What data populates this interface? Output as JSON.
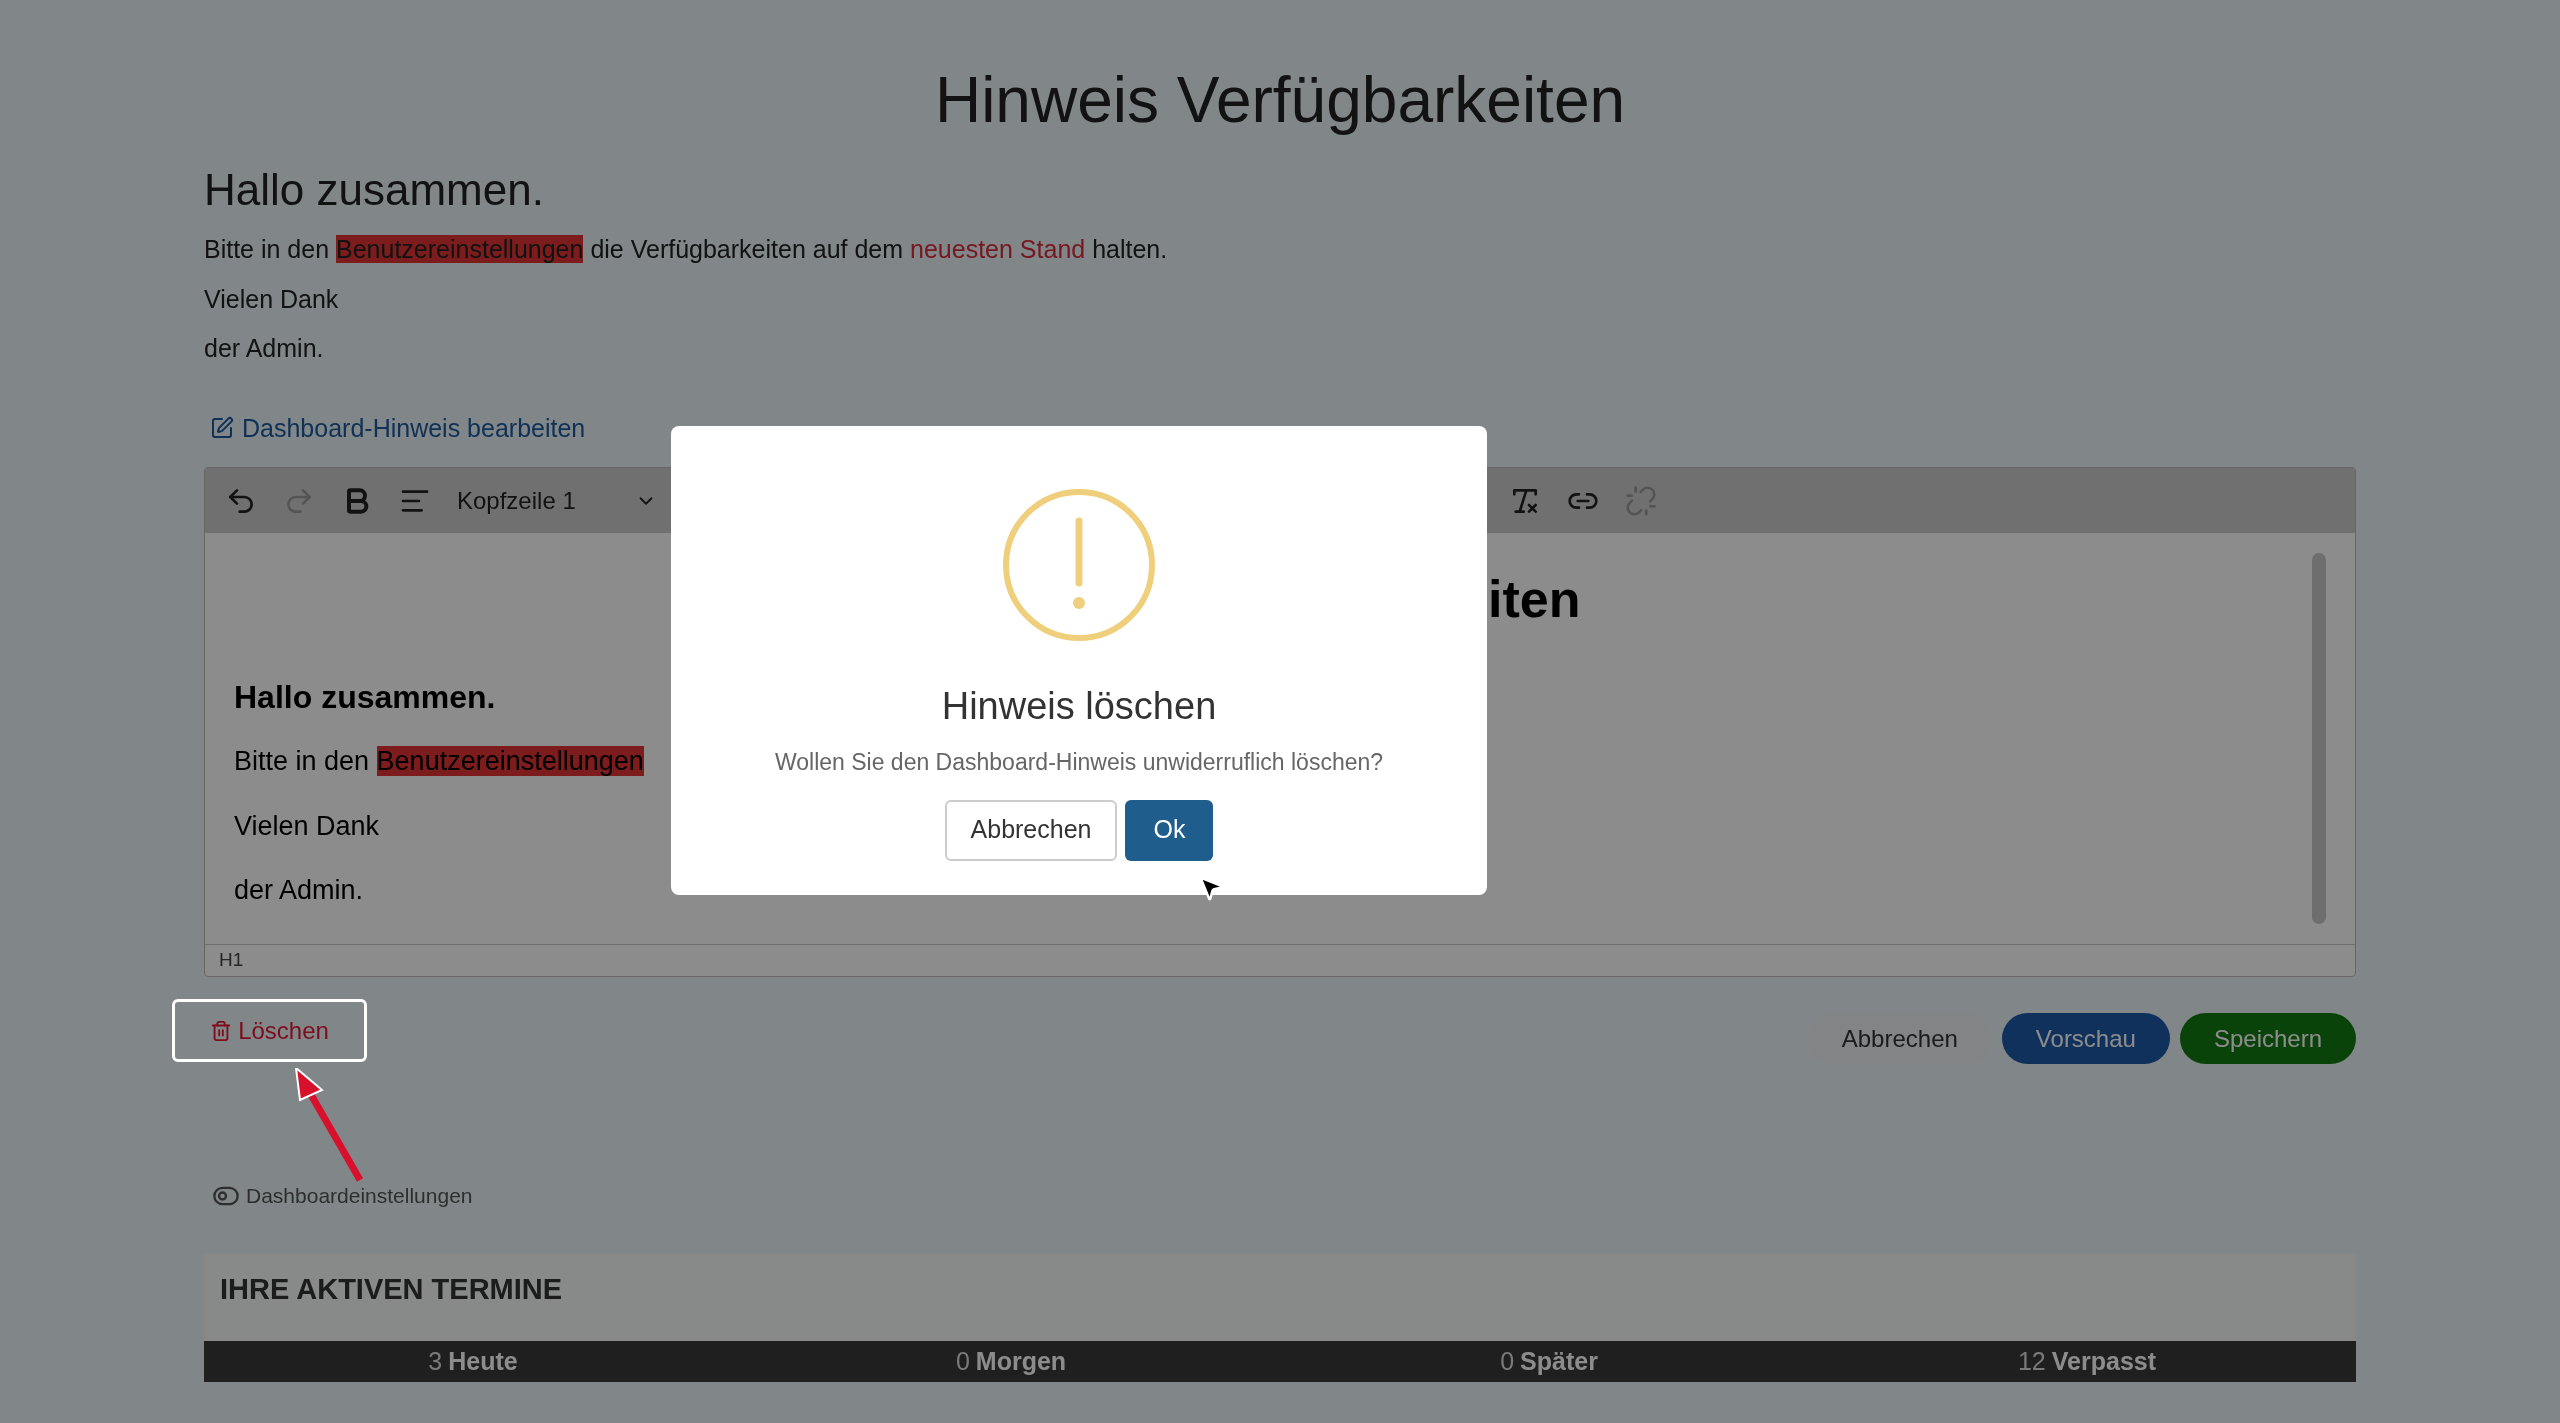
{
  "page_title": "Hinweis Verfügbarkeiten",
  "notice": {
    "heading": "Hallo zusammen.",
    "paragraph": [
      {
        "text": "Bitte in den ",
        "kind": "plain"
      },
      {
        "text": "Benutzereinstellungen",
        "kind": "highlight"
      },
      {
        "text": " die Verfügbarkeiten auf dem ",
        "kind": "plain"
      },
      {
        "text": "neuesten Stand",
        "kind": "red"
      },
      {
        "text": " halten.",
        "kind": "plain"
      }
    ],
    "lines": [
      "Vielen Dank",
      "der Admin."
    ]
  },
  "edit_link": "Dashboard-Hinweis bearbeiten",
  "editor": {
    "toolbar_left": [
      {
        "kind": "undo",
        "disabled": false
      },
      {
        "kind": "redo",
        "disabled": true
      },
      {
        "kind": "bold",
        "disabled": false
      },
      {
        "kind": "align",
        "disabled": false
      }
    ],
    "block_format": "Kopfzeile 1",
    "toolbar_right": [
      {
        "kind": "clear-format",
        "disabled": false
      },
      {
        "kind": "link",
        "disabled": false
      },
      {
        "kind": "unlink",
        "disabled": true
      }
    ],
    "content_heading": "iten",
    "content_heading2": "Hallo zusammen.",
    "content_paragraph": [
      {
        "text": "Bitte in den ",
        "kind": "plain"
      },
      {
        "text": "Benutzereinstellungen",
        "kind": "highlight"
      }
    ],
    "content_lines": [
      "Vielen Dank",
      "der Admin."
    ],
    "status": "H1"
  },
  "delete_button": "Löschen",
  "actions": [
    {
      "kind": "secondary",
      "label": "Abbrechen"
    },
    {
      "kind": "primary",
      "label": "Vorschau"
    },
    {
      "kind": "success",
      "label": "Speichern"
    }
  ],
  "settings_link": "Dashboardeinstellungen",
  "appointments": {
    "title": "IHRE AKTIVEN TERMINE",
    "tabs": [
      {
        "count": "3",
        "label": "Heute"
      },
      {
        "count": "0",
        "label": "Morgen"
      },
      {
        "count": "0",
        "label": "Später"
      },
      {
        "count": "12",
        "label": "Verpasst"
      }
    ]
  },
  "dialog": {
    "title": "Hinweis löschen",
    "message": "Wollen Sie den Dashboard-Hinweis unwiderruflich löschen?",
    "cancel": "Abbrechen",
    "confirm": "Ok"
  }
}
